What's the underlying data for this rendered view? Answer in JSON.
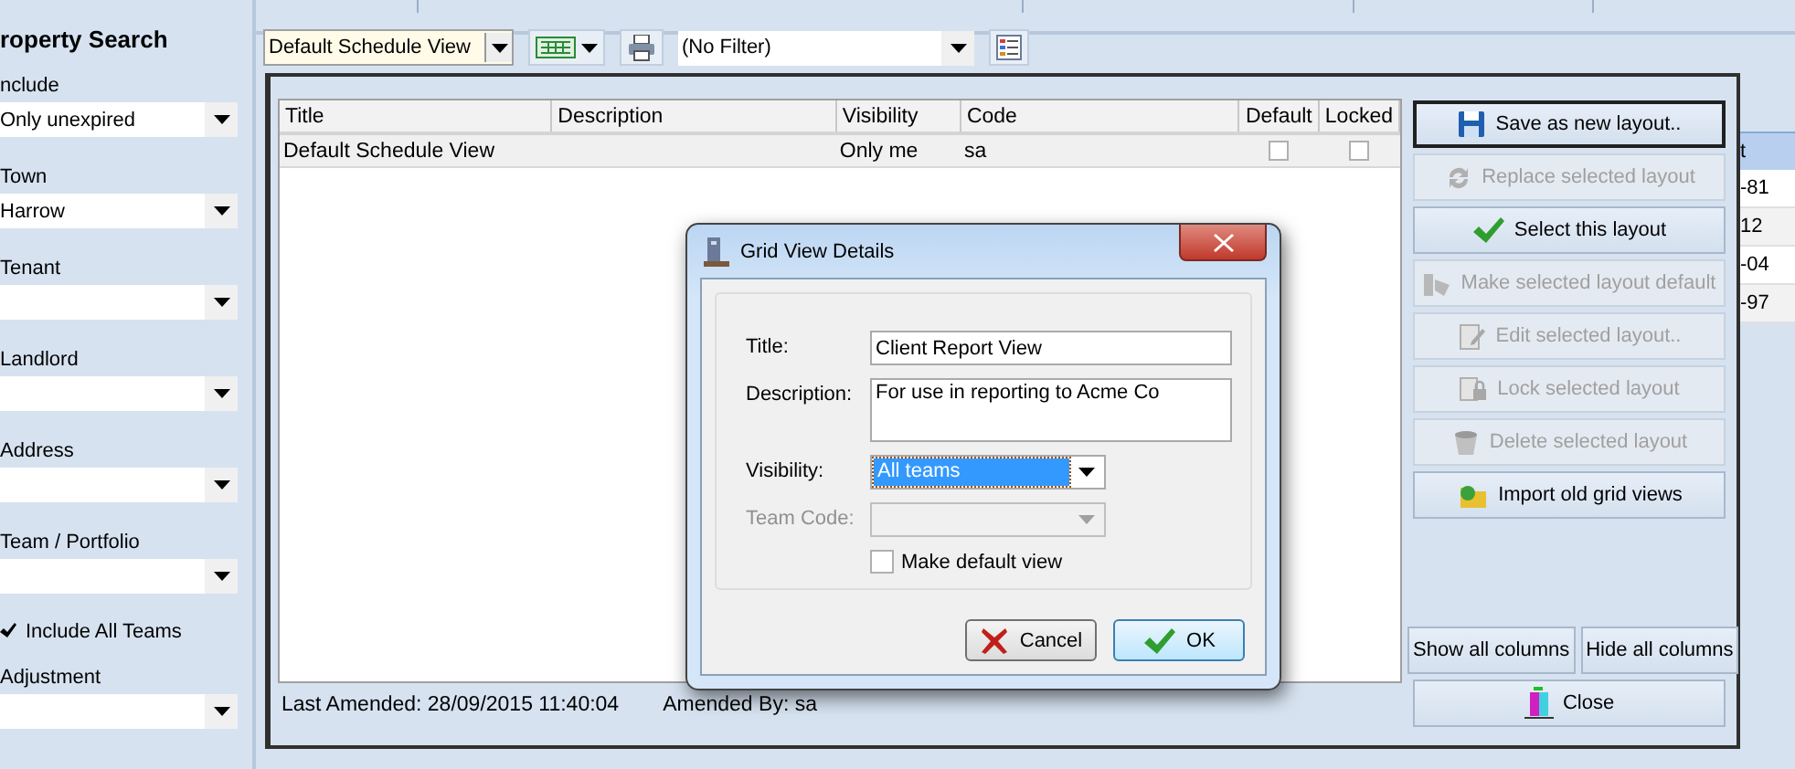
{
  "sidebar": {
    "title": "roperty Search",
    "items": [
      {
        "kind": "dropdown",
        "label": "nclude",
        "value": "Only unexpired"
      },
      {
        "kind": "dropdown",
        "label": "Town",
        "value": "Harrow"
      },
      {
        "kind": "dropdown",
        "label": "Tenant"
      },
      {
        "kind": "dropdown",
        "label": "Landlord"
      },
      {
        "kind": "dropdown",
        "label": "Address"
      },
      {
        "kind": "dropdown",
        "label": "Team / Portfolio"
      },
      {
        "kind": "checkbox",
        "label": "Include All Teams",
        "checked": true
      },
      {
        "kind": "dropdown",
        "label": "Adjustment"
      }
    ]
  },
  "toolbar": {
    "layout_select": "Default Schedule View",
    "filter_select": "(No Filter)"
  },
  "background_grid": {
    "column_header": "t",
    "cells": [
      "-81",
      "12",
      "-04",
      "-97"
    ]
  },
  "layout_window": {
    "columns": [
      "Title",
      "Description",
      "Visibility",
      "Code",
      "Default",
      "Locked"
    ],
    "rows": [
      {
        "title": "Default Schedule View",
        "visibility": "Only me",
        "code": "sa",
        "default": false,
        "locked": false
      }
    ],
    "last_amended": "Last Amended: 28/09/2015 11:40:04",
    "amended_by": "Amended By:  sa",
    "buttons": [
      {
        "label": "Save as new layout..",
        "disabled": false,
        "focused": true
      },
      {
        "label": "Replace selected layout",
        "disabled": true,
        "focused": false
      },
      {
        "label": "Select this layout",
        "disabled": false,
        "focused": false
      },
      {
        "label": "Make selected layout default",
        "disabled": true,
        "focused": false
      },
      {
        "label": "Edit selected layout..",
        "disabled": true,
        "focused": false
      },
      {
        "label": "Lock selected layout",
        "disabled": true,
        "focused": false
      },
      {
        "label": "Delete selected layout",
        "disabled": true,
        "focused": false
      },
      {
        "label": "Import old grid views",
        "disabled": false,
        "focused": false
      }
    ],
    "column_buttons": [
      "Show all columns",
      "Hide all columns"
    ],
    "close_button": "Close"
  },
  "dialog": {
    "title": "Grid View Details",
    "fields": [
      {
        "kind": "text",
        "label": "Title:",
        "value": "Client Report View",
        "disabled": false
      },
      {
        "kind": "textarea",
        "label": "Description:",
        "value": "For use in reporting to Acme Co",
        "disabled": false
      },
      {
        "kind": "select",
        "label": "Visibility:",
        "value": "All teams",
        "disabled": false
      },
      {
        "kind": "select",
        "label": "Team Code:",
        "disabled": true
      }
    ],
    "checkbox": {
      "label": "Make default view",
      "checked": false
    },
    "buttons": [
      "Cancel",
      "OK"
    ]
  }
}
